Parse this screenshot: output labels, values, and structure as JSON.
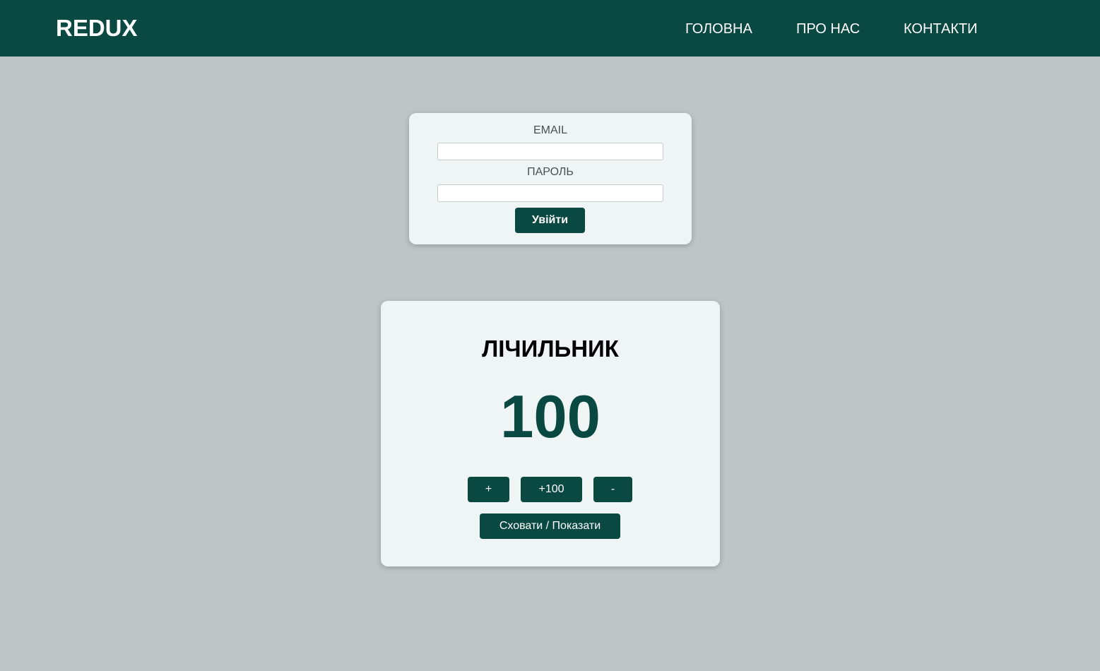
{
  "header": {
    "logo": "REDUX",
    "nav": [
      "ГОЛОВНА",
      "ПРО НАС",
      "КОНТАКТИ"
    ]
  },
  "login": {
    "email_label": "EMAIL",
    "email_value": "",
    "password_label": "ПАРОЛЬ",
    "password_value": "",
    "submit_label": "Увійти"
  },
  "counter": {
    "title": "ЛІЧИЛЬНИК",
    "value": "100",
    "increment_label": "+",
    "increment100_label": "+100",
    "decrement_label": "-",
    "toggle_label": "Сховати / Показати"
  },
  "colors": {
    "primary": "#0a4842",
    "background": "#bfc5c5",
    "card": "#eff5f5"
  }
}
